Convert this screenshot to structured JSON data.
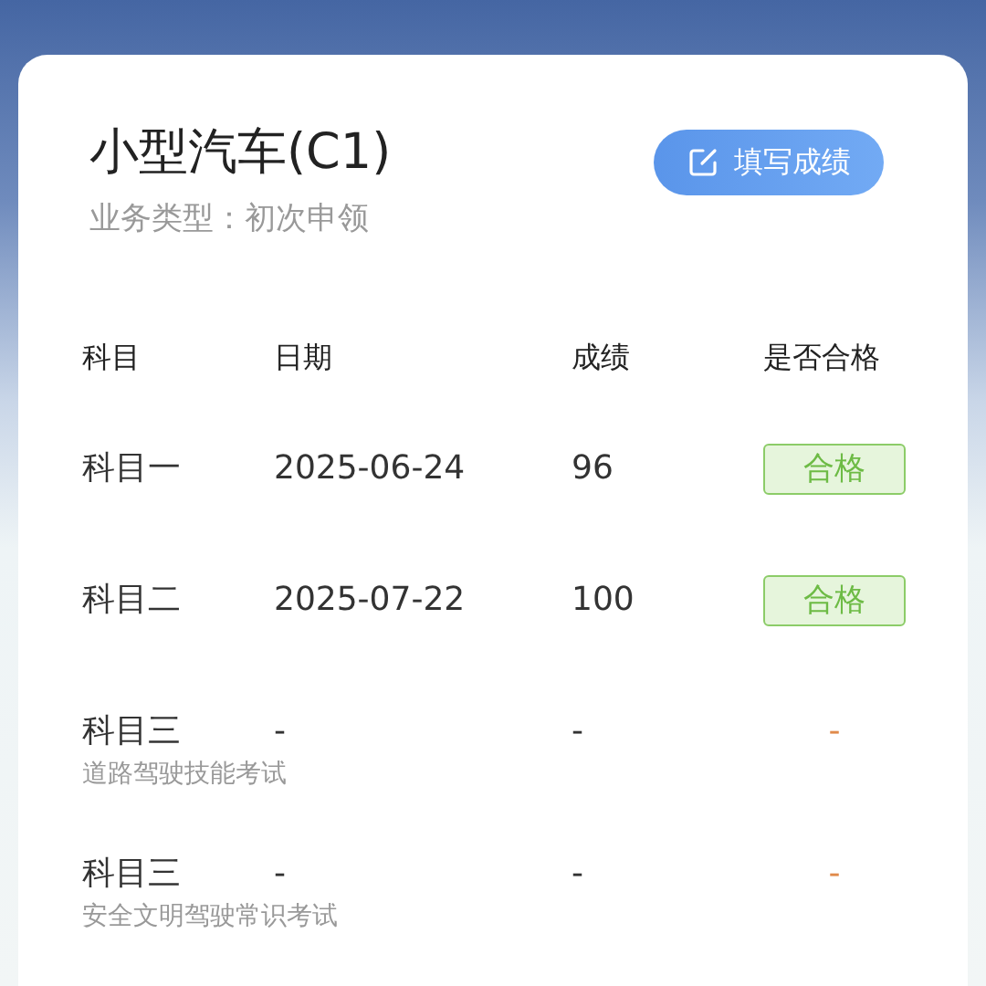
{
  "card": {
    "title": "小型汽车(C1)",
    "subtitle": "业务类型：初次申领",
    "button": "填写成绩"
  },
  "table": {
    "columns": [
      "科目",
      "日期",
      "成绩",
      "是否合格"
    ],
    "rows": [
      {
        "subject": "科目一",
        "date": "2025-06-24",
        "score": "96",
        "result": "合格",
        "kind": "pass"
      },
      {
        "subject": "科目二",
        "date": "2025-07-22",
        "score": "100",
        "result": "合格",
        "kind": "pass"
      },
      {
        "subject": "科目三",
        "note": "道路驾驶技能考试",
        "date": "-",
        "score": "-",
        "result": "-",
        "kind": "pending"
      },
      {
        "subject": "科目三",
        "note": "安全文明驾驶常识考试",
        "date": "-",
        "score": "-",
        "result": "-",
        "kind": "pending"
      }
    ]
  }
}
